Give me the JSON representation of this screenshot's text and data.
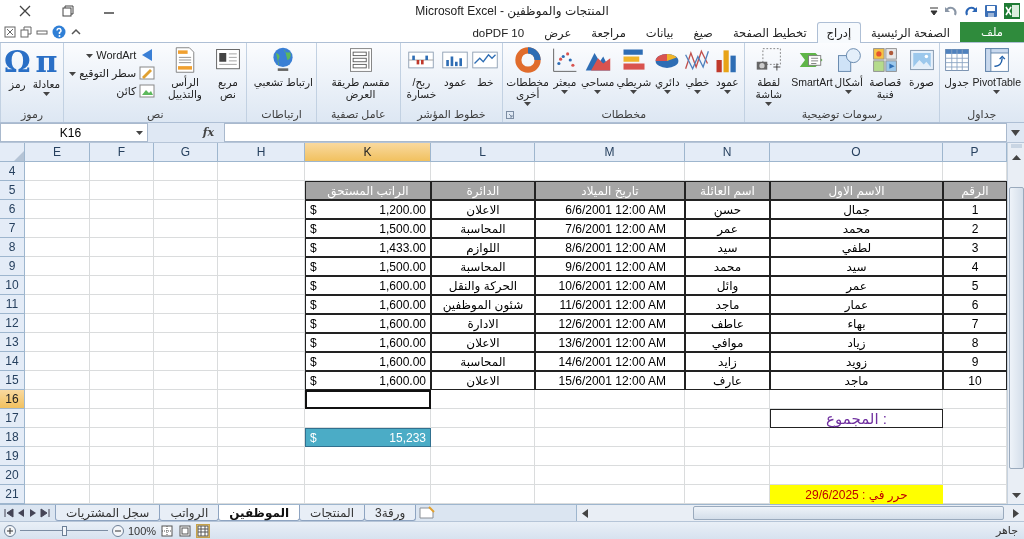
{
  "window": {
    "title": "المنتجات والموظفين - Microsoft Excel"
  },
  "tabs": [
    {
      "label": "ملف",
      "kind": "file",
      "selected": false
    },
    {
      "label": "الصفحة الرئيسية",
      "kind": "tab",
      "selected": false
    },
    {
      "label": "إدراج",
      "kind": "tab",
      "selected": true
    },
    {
      "label": "تخطيط الصفحة",
      "kind": "tab",
      "selected": false
    },
    {
      "label": "صيغ",
      "kind": "tab",
      "selected": false
    },
    {
      "label": "بيانات",
      "kind": "tab",
      "selected": false
    },
    {
      "label": "مراجعة",
      "kind": "tab",
      "selected": false
    },
    {
      "label": "عرض",
      "kind": "tab",
      "selected": false
    },
    {
      "label": "doPDF 10",
      "kind": "tab",
      "selected": false
    }
  ],
  "ribbon": {
    "groups": [
      {
        "label": "جداول",
        "buttons": [
          {
            "label": "PivotTable",
            "kind": "large",
            "dropdown": true
          },
          {
            "label": "جدول",
            "kind": "large",
            "dropdown": false
          }
        ]
      },
      {
        "label": "رسومات توضيحية",
        "buttons": [
          {
            "label": "صورة",
            "kind": "large",
            "dropdown": false
          },
          {
            "label": "قصاصة فنية",
            "kind": "large",
            "dropdown": false
          },
          {
            "label": "أشكال",
            "kind": "large",
            "dropdown": true
          },
          {
            "label": "SmartArt",
            "kind": "large",
            "dropdown": false
          },
          {
            "label": "لقطة شاشة",
            "kind": "large",
            "dropdown": true
          }
        ]
      },
      {
        "label": "مخططات",
        "launcher": true,
        "buttons": [
          {
            "label": "عمود",
            "kind": "large",
            "dropdown": true
          },
          {
            "label": "خطي",
            "kind": "large",
            "dropdown": true
          },
          {
            "label": "دائري",
            "kind": "large",
            "dropdown": true
          },
          {
            "label": "شريطي",
            "kind": "large",
            "dropdown": true
          },
          {
            "label": "مساحي",
            "kind": "large",
            "dropdown": true
          },
          {
            "label": "مبعثر",
            "kind": "large",
            "dropdown": true
          },
          {
            "label": "مخططات أخرى",
            "kind": "large",
            "dropdown": true
          }
        ]
      },
      {
        "label": "خطوط المؤشر",
        "buttons": [
          {
            "label": "خط",
            "kind": "large",
            "dropdown": false
          },
          {
            "label": "عمود",
            "kind": "large",
            "dropdown": false
          },
          {
            "label": "ربح/خسارة",
            "kind": "large",
            "dropdown": false
          }
        ]
      },
      {
        "label": "عامل تصفية",
        "buttons": [
          {
            "label": "مقسم طريقة العرض",
            "kind": "large",
            "dropdown": false
          }
        ]
      },
      {
        "label": "ارتباطات",
        "buttons": [
          {
            "label": "ارتباط تشعبي",
            "kind": "large",
            "dropdown": false
          }
        ]
      },
      {
        "label": "نص",
        "buttons": [
          {
            "label": "مربع نص",
            "kind": "large",
            "dropdown": false
          },
          {
            "label": "الرأس والتذييل",
            "kind": "large",
            "dropdown": false
          },
          {
            "label": "WordArt",
            "kind": "small",
            "dropdown": true
          },
          {
            "label": "سطر التوقيع",
            "kind": "small",
            "dropdown": true
          },
          {
            "label": "كائن",
            "kind": "small",
            "dropdown": false
          }
        ]
      },
      {
        "label": "رموز",
        "buttons": [
          {
            "label": "معادلة",
            "kind": "glyph",
            "glyph": "π",
            "dropdown": true
          },
          {
            "label": "رمز",
            "kind": "glyph",
            "glyph": "Ω",
            "dropdown": false
          }
        ]
      }
    ]
  },
  "formula_bar": {
    "name_box": "K16",
    "fx": "fx"
  },
  "sheet": {
    "columns": [
      {
        "label": "P",
        "selected": false
      },
      {
        "label": "O",
        "selected": false
      },
      {
        "label": "N",
        "selected": false
      },
      {
        "label": "M",
        "selected": false
      },
      {
        "label": "L",
        "selected": false
      },
      {
        "label": "K",
        "selected": true
      },
      {
        "label": "H",
        "selected": false
      },
      {
        "label": "G",
        "selected": false
      },
      {
        "label": "F",
        "selected": false
      },
      {
        "label": "E",
        "selected": false
      }
    ],
    "rows": [
      {
        "label": "4",
        "selected": false
      },
      {
        "label": "5",
        "selected": false
      },
      {
        "label": "6",
        "selected": false
      },
      {
        "label": "7",
        "selected": false
      },
      {
        "label": "8",
        "selected": false
      },
      {
        "label": "9",
        "selected": false
      },
      {
        "label": "10",
        "selected": false
      },
      {
        "label": "11",
        "selected": false
      },
      {
        "label": "12",
        "selected": false
      },
      {
        "label": "13",
        "selected": false
      },
      {
        "label": "14",
        "selected": false
      },
      {
        "label": "15",
        "selected": false
      },
      {
        "label": "16",
        "selected": true
      },
      {
        "label": "17",
        "selected": false
      },
      {
        "label": "18",
        "selected": false
      },
      {
        "label": "19",
        "selected": false
      },
      {
        "label": "20",
        "selected": false
      },
      {
        "label": "21",
        "selected": false
      }
    ],
    "table": {
      "columns": [
        "الرقم",
        "الاسم الاول",
        "اسم العائلة",
        "تاريخ الميلاد",
        "الدائرة",
        "الراتب المستحق"
      ],
      "rows": [
        {
          "number": "1",
          "first_name": "جمال",
          "family_name": "حسن",
          "birth_date": "6/6/2001 12:00 AM",
          "department": "الاعلان",
          "currency": "$",
          "salary": "1,200.00"
        },
        {
          "number": "2",
          "first_name": "محمد",
          "family_name": "عمر",
          "birth_date": "7/6/2001 12:00 AM",
          "department": "المحاسبة",
          "currency": "$",
          "salary": "1,500.00"
        },
        {
          "number": "3",
          "first_name": "لطفي",
          "family_name": "سيد",
          "birth_date": "8/6/2001 12:00 AM",
          "department": "اللوازم",
          "currency": "$",
          "salary": "1,433.00"
        },
        {
          "number": "4",
          "first_name": "سيد",
          "family_name": "محمد",
          "birth_date": "9/6/2001 12:00 AM",
          "department": "المحاسبة",
          "currency": "$",
          "salary": "1,500.00"
        },
        {
          "number": "5",
          "first_name": "عمر",
          "family_name": "وائل",
          "birth_date": "10/6/2001 12:00 AM",
          "department": "الحركة والنقل",
          "currency": "$",
          "salary": "1,600.00"
        },
        {
          "number": "6",
          "first_name": "عمار",
          "family_name": "ماجد",
          "birth_date": "11/6/2001 12:00 AM",
          "department": "شئون الموظفين",
          "currency": "$",
          "salary": "1,600.00"
        },
        {
          "number": "7",
          "first_name": "بهاء",
          "family_name": "عاطف",
          "birth_date": "12/6/2001 12:00 AM",
          "department": "الادارة",
          "currency": "$",
          "salary": "1,600.00"
        },
        {
          "number": "8",
          "first_name": "زياد",
          "family_name": "موافي",
          "birth_date": "13/6/2001 12:00 AM",
          "department": "الاعلان",
          "currency": "$",
          "salary": "1,600.00"
        },
        {
          "number": "9",
          "first_name": "زويد",
          "family_name": "زايد",
          "birth_date": "14/6/2001 12:00 AM",
          "department": "المحاسبة",
          "currency": "$",
          "salary": "1,600.00"
        },
        {
          "number": "10",
          "first_name": "ماجد",
          "family_name": "عارف",
          "birth_date": "15/6/2001 12:00 AM",
          "department": "الاعلان",
          "currency": "$",
          "salary": "1,600.00"
        }
      ]
    },
    "total": {
      "label": "المجموع :",
      "currency": "$",
      "value": "15,233"
    },
    "issued": "حرر في : 29/6/2025"
  },
  "sheet_tabs": [
    {
      "label": "ورقة3",
      "selected": false
    },
    {
      "label": "المنتجات",
      "selected": false
    },
    {
      "label": "الموظفين",
      "selected": true
    },
    {
      "label": "الرواتب",
      "selected": false
    },
    {
      "label": "سجل المشتريات",
      "selected": false
    }
  ],
  "status_bar": {
    "zoom": "100%",
    "zoom_slider": {
      "level": 0.5
    },
    "views": [
      {
        "kind": "page-break",
        "selected": false
      },
      {
        "kind": "page-layout",
        "selected": false
      },
      {
        "kind": "normal",
        "selected": true
      }
    ],
    "status": "جاهر"
  }
}
